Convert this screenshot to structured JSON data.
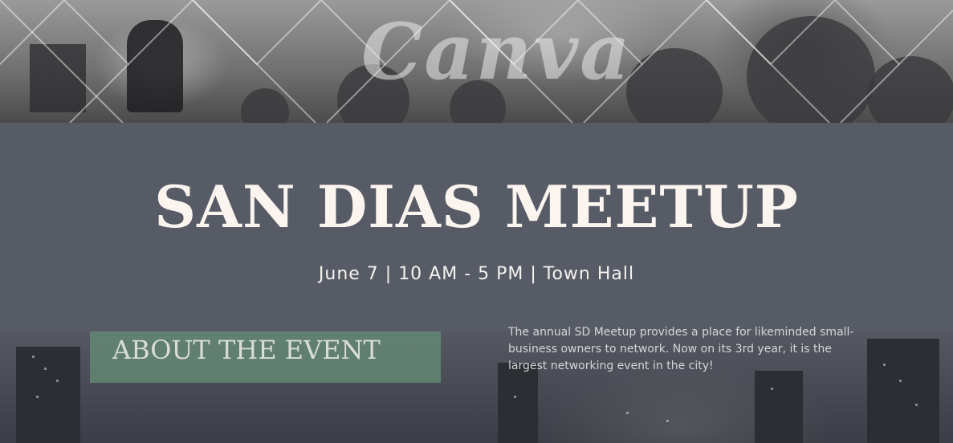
{
  "watermark": "Canva",
  "event": {
    "title": "SAN DIAS MEETUP",
    "details": "June 7 | 10 AM - 5 PM | Town Hall"
  },
  "about": {
    "heading": "ABOUT THE EVENT",
    "text": "The annual SD Meetup provides a place for likeminded small-business owners to network. Now on its 3rd year, it is the largest networking event in the city!"
  },
  "colors": {
    "title_band": "#575b66",
    "about_box": "#648c76",
    "title_text": "#fbf4ef"
  }
}
